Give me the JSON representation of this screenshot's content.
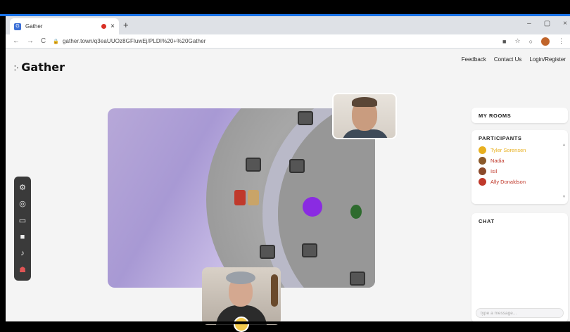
{
  "browser": {
    "tab_title": "Gather",
    "tab_close": "×",
    "new_tab": "+",
    "window_controls": [
      "–",
      "▢",
      "×"
    ],
    "nav": {
      "back": "←",
      "forward": "→",
      "reload": "C"
    },
    "url": "gather.town/q3eaUUOz8GFluwEj/PLDI%20+%20Gather"
  },
  "header": {
    "logo_text": "Gather",
    "links": [
      "Feedback",
      "Contact Us",
      "Login/Register"
    ]
  },
  "toolbar": {
    "icons": [
      "gear-icon",
      "target-icon",
      "screen-icon",
      "camera-icon",
      "mic-icon",
      "person-icon"
    ]
  },
  "sidebar": {
    "my_rooms_title": "MY ROOMS",
    "participants_title": "PARTICIPANTS",
    "participants": [
      {
        "name": "Tyler Sorensen",
        "color": "#e8b020",
        "avatar_color": "#e8b020"
      },
      {
        "name": "Nadia",
        "color": "#c0392b",
        "avatar_color": "#8b5a2b"
      },
      {
        "name": "Isil",
        "color": "#c0392b",
        "avatar_color": "#8b4a2b"
      },
      {
        "name": "Ally Donaldson",
        "color": "#c0392b",
        "avatar_color": "#c0392b"
      }
    ],
    "chat_title": "CHAT",
    "chat_placeholder": "type a message..."
  },
  "colors": {
    "accent": "#1a73e8",
    "map_avatar": "#8a2be2"
  }
}
